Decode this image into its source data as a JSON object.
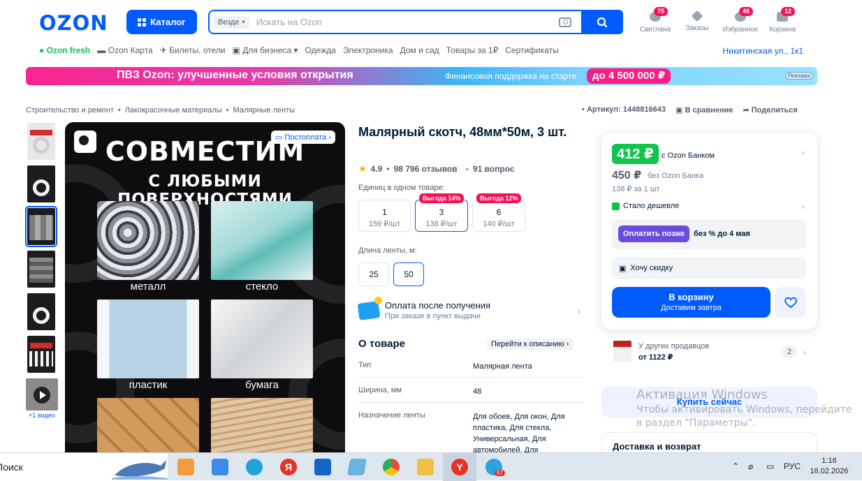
{
  "header": {
    "logo": "OZON",
    "catalog_label": "Каталог",
    "search": {
      "scope": "Везде",
      "placeholder": "Искать на Ozon"
    },
    "user": {
      "label": "Светлана",
      "badge": "75"
    },
    "orders": {
      "label": "Заказы"
    },
    "favorites": {
      "label": "Избранное",
      "badge": "48"
    },
    "cart": {
      "label": "Корзина",
      "badge": "12"
    }
  },
  "nav": {
    "items": [
      "Ozon fresh",
      "Ozon Карта",
      "Билеты, отели",
      "Для бизнеса",
      "Одежда",
      "Электроника",
      "Дом и сад",
      "Товары за 1₽",
      "Сертификаты"
    ],
    "address": "Никитинская ул., 1к1"
  },
  "banner": {
    "headline": "ПВЗ Ozon: улучшенные условия открытия",
    "sub": "Финансовая поддержка на старте",
    "amount": "до 4 500 000 ₽",
    "ad_label": "Реклама"
  },
  "breadcrumbs": [
    "Строительство и ремонт",
    "Лакокрасочные материалы",
    "Малярные ленты"
  ],
  "meta": {
    "article": "Артикул: 1448816643",
    "compare": "В сравнение",
    "share": "Поделиться"
  },
  "gallery": {
    "video_label": "+1 видео",
    "postpay_label": "Постоплата",
    "image_heading_1": "СОВМЕСТИМ",
    "image_heading_2": "С ЛЮБЫМИ ПОВЕРХНОСТЯМИ",
    "tiles": [
      "металл",
      "стекло",
      "пластик",
      "бумага"
    ]
  },
  "product": {
    "title": "Малярный скотч, 48мм*50м, 3 шт.",
    "rating": "4.9",
    "reviews": "98 796 отзывов",
    "questions": "91 вопрос",
    "units_label": "Единиц в одном товаре:",
    "units": [
      {
        "n": "1",
        "price": "159 ₽/шт",
        "tag": ""
      },
      {
        "n": "3",
        "price": "138 ₽/шт",
        "tag": "Выгода 14%"
      },
      {
        "n": "6",
        "price": "140 ₽/шт",
        "tag": "Выгода 12%"
      }
    ],
    "length_label": "Длина ленты, м:",
    "lengths": [
      "25",
      "50"
    ],
    "pay_after": {
      "title": "Оплата после получения",
      "sub": "При заказе в пункт выдачи"
    },
    "about_title": "О товаре",
    "about_link": "Перейти к описанию",
    "specs": [
      {
        "k": "Тип",
        "v": "Малярная лента"
      },
      {
        "k": "Ширина, мм",
        "v": "48"
      },
      {
        "k": "Назначение ленты",
        "v": "Для обоев, Для окон, Для пластика, Для стекла, Универсальная, Для автомобилей, Для"
      }
    ]
  },
  "buybox": {
    "price_bank": "412 ₽",
    "with_bank": "с Ozon Банком",
    "price": "450 ₽",
    "no_bank": "без Ozon Банка",
    "per_piece": "138 ₽ за 1 шт",
    "cheaper": "Стало дешевле",
    "pay_later_btn": "Оплатить позже",
    "pay_later_text": "без % до 4 мая",
    "want_discount": "Хочу скидку",
    "cart_btn": "В корзину",
    "cart_sub": "Доставим завтра",
    "other_sellers": "У других продавцов",
    "other_price": "от 1122 ₽",
    "other_count": "2",
    "buy_now": "Купить сейчас",
    "delivery_title": "Доставка и возврат"
  },
  "windows_activation": {
    "title": "Активация Windows",
    "text": "Чтобы активировать Windows, перейдите в раздел \"Параметры\"."
  },
  "taskbar": {
    "search_text": "Поиск",
    "lang": "РУС",
    "time": "1:16",
    "date": "16.02.2026",
    "telegram_badge": "57"
  }
}
